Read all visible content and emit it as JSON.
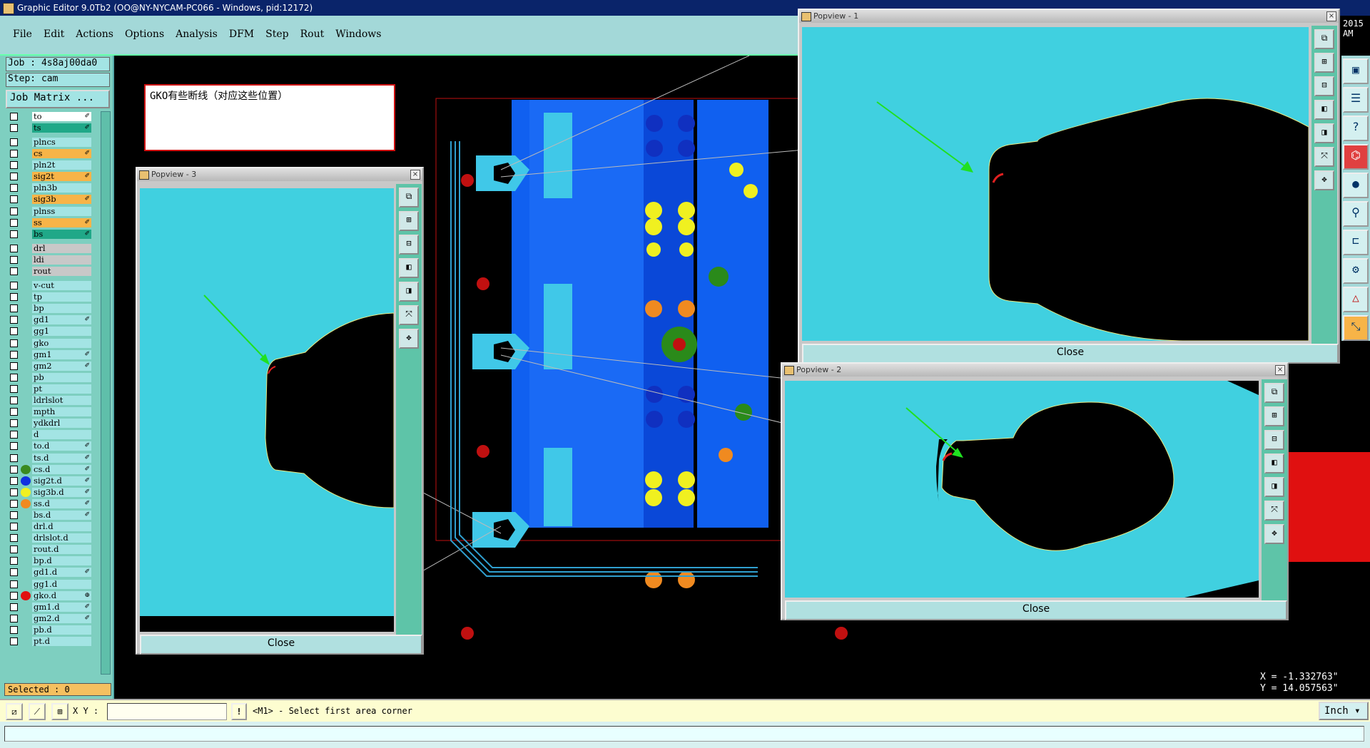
{
  "window": {
    "title": "Graphic Editor 9.0Tb2 (OO@NY-NYCAM-PC066 - Windows, pid:12172)"
  },
  "menu": [
    "File",
    "Edit",
    "Actions",
    "Options",
    "Analysis",
    "DFM",
    "Step",
    "Rout",
    "Windows"
  ],
  "job": {
    "job_line": "Job : 4s8aj00da0",
    "step_line": "Step: cam",
    "matrix_button": "Job Matrix ..."
  },
  "layers": [
    {
      "name": "to",
      "style": "board",
      "flag": "✐"
    },
    {
      "name": "ts",
      "style": "green",
      "flag": "✐"
    },
    {
      "name": "plncs",
      "style": "normal",
      "flag": ""
    },
    {
      "name": "cs",
      "style": "orange",
      "flag": "✐"
    },
    {
      "name": "pln2t",
      "style": "normal",
      "flag": ""
    },
    {
      "name": "sig2t",
      "style": "orange",
      "flag": "✐"
    },
    {
      "name": "pln3b",
      "style": "normal",
      "flag": ""
    },
    {
      "name": "sig3b",
      "style": "orange",
      "flag": "✐"
    },
    {
      "name": "plnss",
      "style": "normal",
      "flag": ""
    },
    {
      "name": "ss",
      "style": "orange",
      "flag": "✐"
    },
    {
      "name": "bs",
      "style": "green",
      "flag": "✐"
    },
    {
      "name": "drl",
      "style": "gray",
      "flag": ""
    },
    {
      "name": "ldi",
      "style": "gray",
      "flag": ""
    },
    {
      "name": "rout",
      "style": "gray",
      "flag": ""
    },
    {
      "name": "v-cut",
      "style": "normal",
      "flag": ""
    },
    {
      "name": "tp",
      "style": "normal",
      "flag": ""
    },
    {
      "name": "bp",
      "style": "normal",
      "flag": ""
    },
    {
      "name": "gd1",
      "style": "normal",
      "flag": "✐"
    },
    {
      "name": "gg1",
      "style": "normal",
      "flag": ""
    },
    {
      "name": "gko",
      "style": "normal",
      "flag": ""
    },
    {
      "name": "gm1",
      "style": "normal",
      "flag": "✐"
    },
    {
      "name": "gm2",
      "style": "normal",
      "flag": "✐"
    },
    {
      "name": "pb",
      "style": "normal",
      "flag": ""
    },
    {
      "name": "pt",
      "style": "normal",
      "flag": ""
    },
    {
      "name": "ldrlslot",
      "style": "normal",
      "flag": ""
    },
    {
      "name": "mpth",
      "style": "normal",
      "flag": ""
    },
    {
      "name": "ydkdrl",
      "style": "normal",
      "flag": ""
    },
    {
      "name": "d",
      "style": "normal",
      "flag": ""
    },
    {
      "name": "to.d",
      "style": "normal",
      "flag": "✐"
    },
    {
      "name": "ts.d",
      "style": "normal",
      "flag": "✐"
    },
    {
      "name": "cs.d",
      "style": "normal",
      "flag": "✐",
      "dot": "#3a8a20"
    },
    {
      "name": "sig2t.d",
      "style": "normal",
      "flag": "✐",
      "dot": "#1030e0"
    },
    {
      "name": "sig3b.d",
      "style": "normal",
      "flag": "✐",
      "dot": "#f0f020"
    },
    {
      "name": "ss.d",
      "style": "normal",
      "flag": "✐",
      "dot": "#f08a20"
    },
    {
      "name": "bs.d",
      "style": "normal",
      "flag": "✐"
    },
    {
      "name": "drl.d",
      "style": "normal",
      "flag": ""
    },
    {
      "name": "drlslot.d",
      "style": "normal",
      "flag": ""
    },
    {
      "name": "rout.d",
      "style": "normal",
      "flag": ""
    },
    {
      "name": "bp.d",
      "style": "normal",
      "flag": ""
    },
    {
      "name": "gd1.d",
      "style": "normal",
      "flag": "✐"
    },
    {
      "name": "gg1.d",
      "style": "normal",
      "flag": ""
    },
    {
      "name": "gko.d",
      "style": "normal",
      "flag": "⊕",
      "dot": "#e01010"
    },
    {
      "name": "gm1.d",
      "style": "normal",
      "flag": "✐"
    },
    {
      "name": "gm2.d",
      "style": "normal",
      "flag": "✐"
    },
    {
      "name": "pb.d",
      "style": "normal",
      "flag": ""
    },
    {
      "name": "pt.d",
      "style": "normal",
      "flag": ""
    }
  ],
  "selected_label": "Selected : 0",
  "note": "GKO有些断线（对应这些位置）",
  "popups": {
    "p1": {
      "title": "Popview - 1",
      "close": "Close"
    },
    "p2": {
      "title": "Popview - 2",
      "close": "Close"
    },
    "p3": {
      "title": "Popview - 3",
      "close": "Close"
    }
  },
  "coords": {
    "x": "X = -1.332763\"",
    "y": "Y = 14.057563\""
  },
  "clock": "2015 AM",
  "cmd": {
    "xy_label": "X Y :",
    "xy_value": "",
    "bang": "!",
    "prompt": "<M1> - Select first area corner",
    "units": "Inch"
  },
  "colors": {
    "popview_bg": "#40d0e0",
    "arrow": "#20e020",
    "break_mark": "#e02020"
  }
}
